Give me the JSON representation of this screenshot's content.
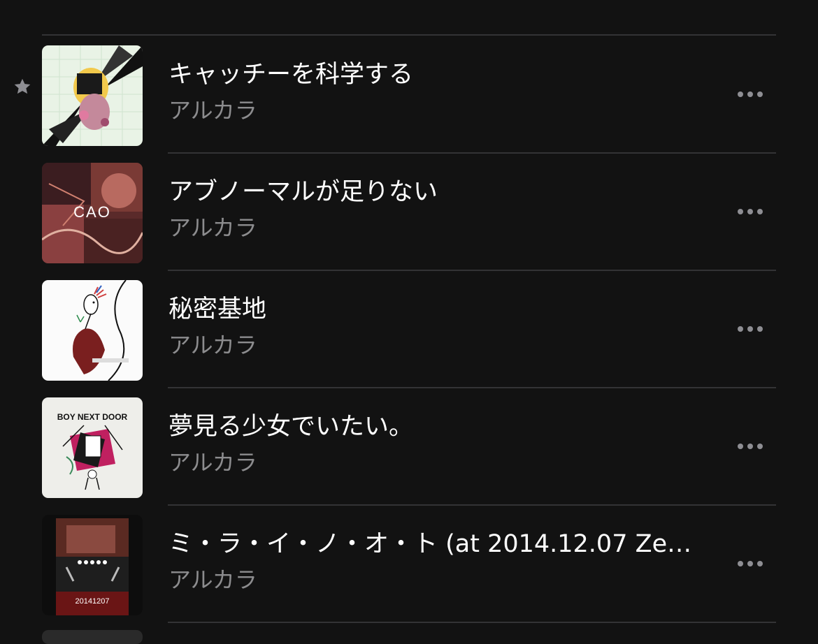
{
  "songs": [
    {
      "title": "キャッチーを科学する",
      "artist": "アルカラ",
      "favorited": true,
      "artwork_icon": "album-artwork-catchy"
    },
    {
      "title": "アブノーマルが足りない",
      "artist": "アルカラ",
      "favorited": false,
      "artwork_icon": "album-artwork-cao",
      "artwork_text": "CAO"
    },
    {
      "title": "秘密基地",
      "artist": "アルカラ",
      "favorited": false,
      "artwork_icon": "album-artwork-himitsu"
    },
    {
      "title": "夢見る少女でいたい。",
      "artist": "アルカラ",
      "favorited": false,
      "artwork_icon": "album-artwork-boy-next-door",
      "artwork_text": "BOY NEXT DOOR"
    },
    {
      "title": "ミ・ラ・イ・ノ・オ・ト (at 2014.12.07 Ze…",
      "artist": "アルカラ",
      "favorited": false,
      "artwork_icon": "album-artwork-20141207",
      "artwork_text": "20141207"
    }
  ],
  "colors": {
    "background": "#121212",
    "title": "#ffffff",
    "subtitle": "#8c8c8e",
    "divider": "#333335",
    "more_dots": "#8e8e93",
    "star": "#8e8e93"
  }
}
